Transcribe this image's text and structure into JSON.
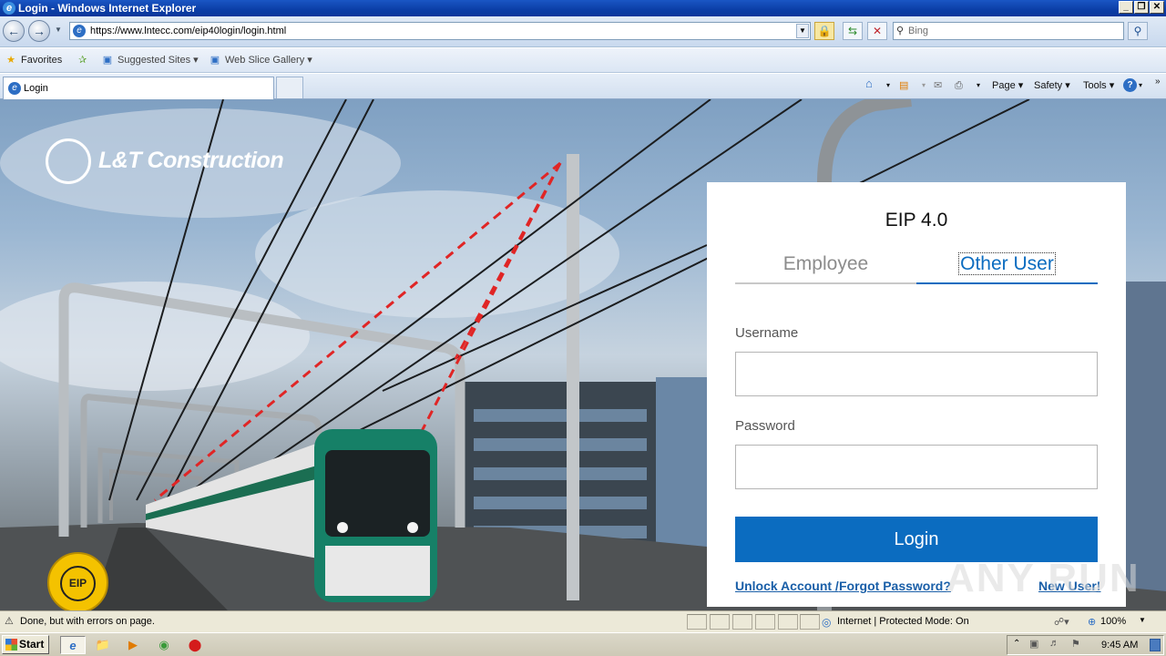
{
  "window": {
    "title": "Login - Windows Internet Explorer",
    "controls": [
      "_",
      "❐",
      "✕"
    ]
  },
  "address_bar": {
    "url": "https://www.lntecc.com/eip40login/login.html",
    "search_placeholder": "Bing"
  },
  "favorites_bar": {
    "favorites_label": "Favorites",
    "items": [
      "Suggested Sites ▾",
      "Web Slice Gallery ▾"
    ]
  },
  "tabs": [
    {
      "label": "Login"
    }
  ],
  "command_bar": {
    "page": "Page ▾",
    "safety": "Safety ▾",
    "tools": "Tools ▾"
  },
  "page": {
    "brand": "L&T Construction",
    "seal_text": "EIP",
    "login": {
      "title": "EIP 4.0",
      "tab_employee": "Employee",
      "tab_other_user": "Other User",
      "username_label": "Username",
      "username_value": "",
      "password_label": "Password",
      "password_value": "",
      "login_button": "Login",
      "unlock_account": "Unlock Account /",
      "forgot_password": "Forgot Password?",
      "new_user": "New User!"
    },
    "watermark": "ANY RUN"
  },
  "status_bar": {
    "text": "Done, but with errors on page.",
    "zone": "Internet | Protected Mode: On",
    "zoom": "100%"
  },
  "taskbar": {
    "start": "Start",
    "clock": "9:45 AM"
  },
  "colors": {
    "accent_blue": "#0b6cc0",
    "tab_inactive": "#8c8c8c",
    "link_blue": "#1a5fa8",
    "seal_yellow": "#f4c200"
  }
}
